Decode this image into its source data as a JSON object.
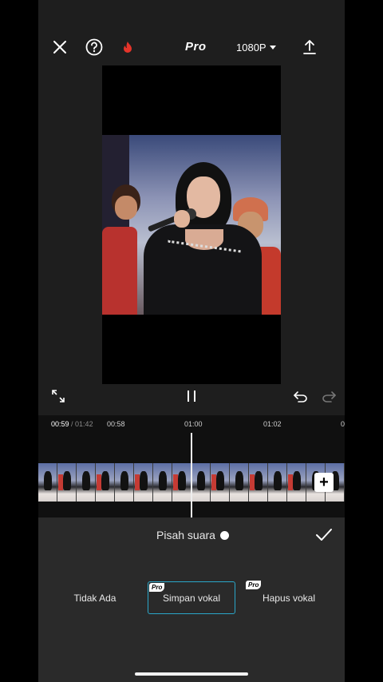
{
  "topbar": {
    "pro_label": "Pro",
    "resolution": "1080P",
    "icons": [
      "close-icon",
      "help-icon",
      "fire-icon",
      "export-icon"
    ]
  },
  "timeline": {
    "current_time": "00:59",
    "total_time": "01:42",
    "ticks": [
      "00:58",
      "01:00",
      "01:02",
      "0"
    ],
    "add_clip_label": "+"
  },
  "panel": {
    "title": "Pisah suara",
    "options": [
      {
        "label": "Tidak Ada",
        "pro": false,
        "selected": false
      },
      {
        "label": "Simpan vokal",
        "pro": true,
        "selected": true
      },
      {
        "label": "Hapus vokal",
        "pro": true,
        "selected": false
      }
    ],
    "pro_badge": "Pro"
  },
  "colors": {
    "selected_border": "#2aa7c9",
    "fire_icon": "#e5342a",
    "panel_bg": "#2a2a2a",
    "editor_bg": "#1e1e1e"
  }
}
